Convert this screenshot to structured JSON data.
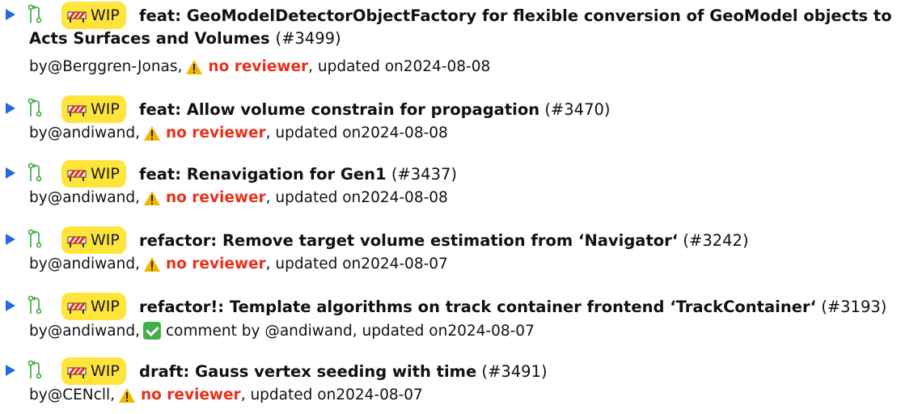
{
  "badge_label": "WIP",
  "by_prefix": "by ",
  "updated_prefix": ", updated on ",
  "no_reviewer_label": "no reviewer",
  "items": [
    {
      "title": "feat: GeoModelDetectorObjectFactory for flexible conversion of GeoModel objects to",
      "title_cont": "Acts Surfaces and Volumes",
      "pr": "(#3499)",
      "author": "@Berggren-Jonas,",
      "status": "no reviewer",
      "date": "2024-08-08"
    },
    {
      "title": "feat: Allow volume constrain for propagation",
      "pr": "(#3470)",
      "author": "@andiwand,",
      "status": "no reviewer",
      "date": "2024-08-08"
    },
    {
      "title": "feat: Renavigation for Gen1",
      "pr": "(#3437)",
      "author": "@andiwand,",
      "status": "no reviewer",
      "date": "2024-08-08"
    },
    {
      "title": "refactor: Remove target volume estimation from ‘Navigator‘",
      "pr": "(#3242)",
      "author": "@andiwand,",
      "status": "no reviewer",
      "date": "2024-08-07"
    },
    {
      "title": "refactor!: Template algorithms on track container frontend ‘TrackContainer‘",
      "pr": "(#3193)",
      "author": "@andiwand,",
      "status": "comment by @andiwand",
      "date": "2024-08-07"
    },
    {
      "title": "draft: Gauss vertex seeding with time",
      "pr": "(#3491)",
      "author": "@CENcll,",
      "status": "no reviewer",
      "date": "2024-08-07"
    }
  ],
  "colors": {
    "accent": "#2667e8",
    "badge": "#ffe53b",
    "warning_text": "#e8301c",
    "check": "#43b047"
  }
}
